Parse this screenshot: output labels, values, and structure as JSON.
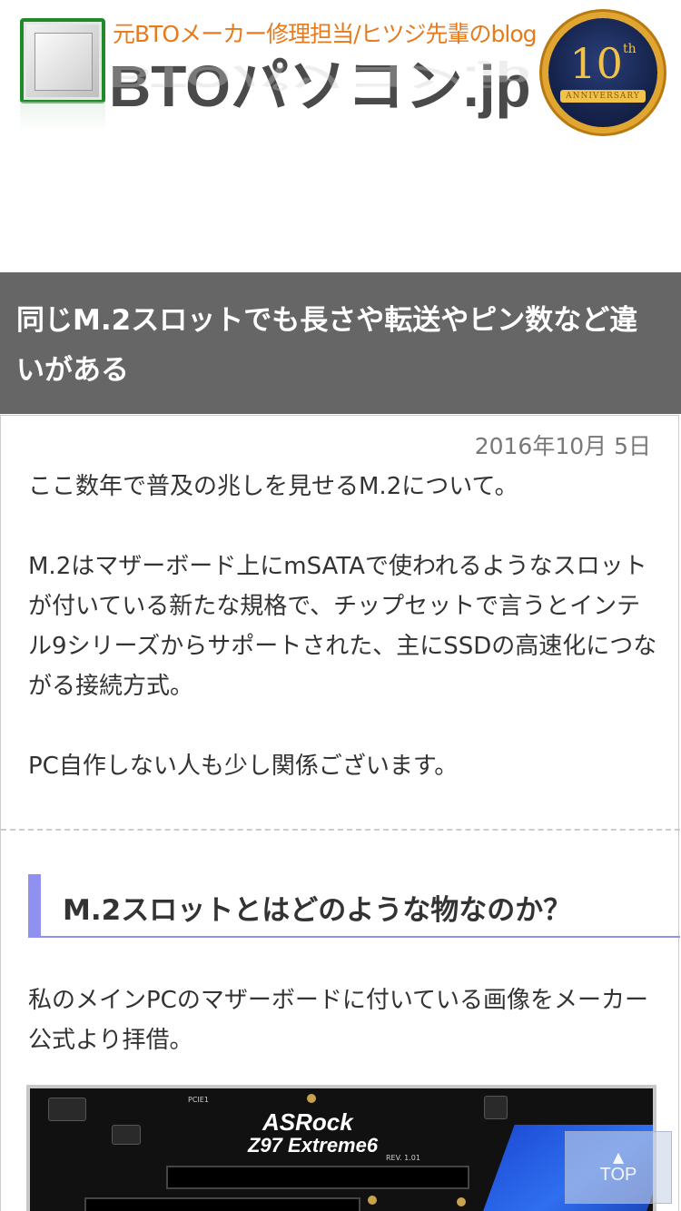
{
  "header": {
    "tagline": "元BTOメーカー修理担当/ヒツジ先輩のblog",
    "site_name": "BTOパソコン.jp",
    "badge_number": "10",
    "badge_suffix": "th",
    "badge_text": "ANNIVERSARY"
  },
  "article": {
    "title": "同じM.2スロットでも長さや転送やピン数など違いがある",
    "date": "2016年10月 5日",
    "intro": [
      "ここ数年で普及の兆しを見せるM.2について。",
      "M.2はマザーボード上にmSATAで使われるようなスロットが付いている新たな規格で、チップセットで言うとインテル9シリーズからサポートされた、主にSSDの高速化につながる接続方式。",
      "PC自作しない人も少し関係ございます。"
    ],
    "section_heading": "M.2スロットとはどのような物なのか？",
    "section_para": "私のメインPCのマザーボードに付いている画像をメーカー公式より拝借。",
    "image": {
      "brand": "ASRock",
      "model": "Z97 Extreme6",
      "label_pcie": "PCIE1",
      "label_rev": "REV. 1.01"
    }
  },
  "to_top": {
    "arrow": "▲",
    "label": "TOP"
  },
  "colors": {
    "title_band": "#666666",
    "heading_accent": "#9090f0",
    "tagline": "#e87a1a"
  }
}
